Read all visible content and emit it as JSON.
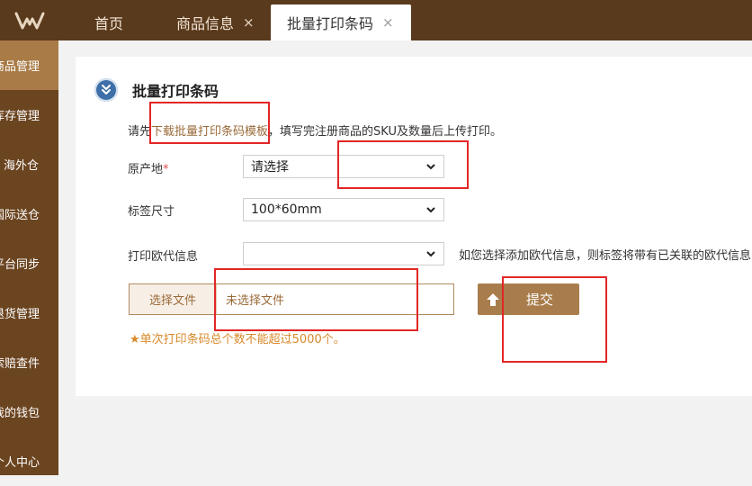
{
  "tabs": [
    {
      "label": "首页",
      "closable": false,
      "active": false
    },
    {
      "label": "商品信息",
      "closable": true,
      "active": false
    },
    {
      "label": "批量打印条码",
      "closable": true,
      "active": true
    }
  ],
  "close_glyph": "×",
  "sidebar": {
    "items": [
      {
        "label": "商品管理",
        "active": true
      },
      {
        "label": "库存管理",
        "active": false
      },
      {
        "label": "海外仓",
        "active": false
      },
      {
        "label": "国际送仓",
        "active": false
      },
      {
        "label": "平台同步",
        "active": false
      },
      {
        "label": "退货管理",
        "active": false
      },
      {
        "label": "索赔查件",
        "active": false
      },
      {
        "label": "我的钱包",
        "active": false
      },
      {
        "label": "个人中心",
        "active": false
      }
    ]
  },
  "page": {
    "title": "批量打印条码",
    "instruction_prefix": "请先",
    "instruction_link": "下载批量打印条码模板",
    "instruction_suffix": "，填写完注册商品的SKU及数量后上传打印。"
  },
  "form": {
    "origin_label": "原产地",
    "required_mark": "*",
    "origin_value": "请选择",
    "size_label": "标签尺寸",
    "size_value": "100*60mm",
    "eu_label": "打印欧代信息",
    "eu_value": "",
    "eu_hint": "如您选择添加欧代信息，则标签将带有已关联的欧代信息",
    "file_button": "选择文件",
    "file_placeholder": "未选择文件",
    "submit_label": "提交",
    "note_star": "★",
    "note": "单次打印条码总个数不能超过5000个。"
  },
  "colors": {
    "topbar": "#5a3a1c",
    "sidebar": "#6b4420",
    "sidebar_active": "#a97b47",
    "accent": "#a87d4b",
    "link": "#9a6a3a",
    "annotation": "#e32626"
  },
  "icons": {
    "logo": "brand-logo-icon",
    "title": "download-circle-icon",
    "chevron": "chevron-down-icon",
    "submit": "upload-arrow-icon",
    "close": "close-icon"
  }
}
